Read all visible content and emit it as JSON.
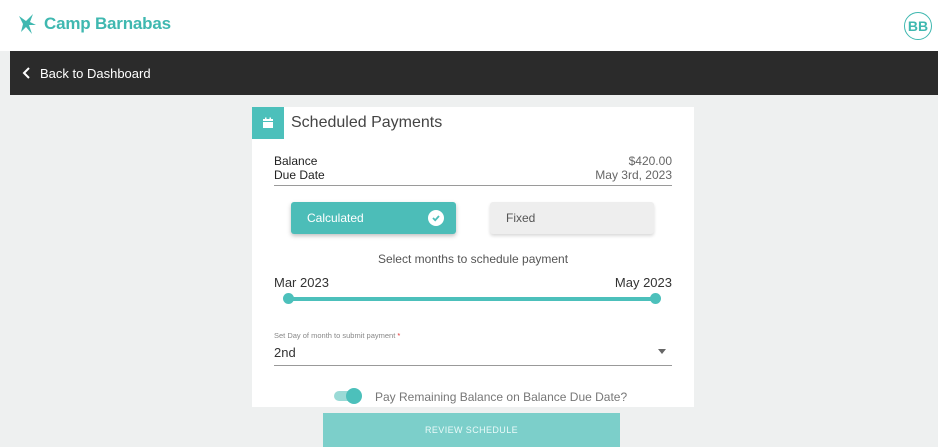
{
  "brand": {
    "name": "Camp Barnabas",
    "accent": "#3fb8b0"
  },
  "user": {
    "initials": "BB"
  },
  "nav": {
    "back_label": "Back to Dashboard"
  },
  "card": {
    "title": "Scheduled Payments",
    "balance_label": "Balance",
    "balance_value": "$420.00",
    "due_label": "Due Date",
    "due_value": "May 3rd, 2023",
    "mode_options": [
      "Calculated",
      "Fixed"
    ],
    "mode_selected": "Calculated",
    "months_prompt": "Select months to schedule payment",
    "month_start": "Mar 2023",
    "month_end": "May 2023",
    "day_field_label": "Set Day of month to submit payment",
    "day_field_required": "*",
    "day_field_value": "2nd",
    "toggle_label": "Pay Remaining Balance on Balance Due Date?",
    "toggle_on": true
  },
  "actions": {
    "review_label": "REVIEW SCHEDULE"
  },
  "icons": [
    "camp-barnabas-logo-icon",
    "chevron-left-icon",
    "calendar-icon",
    "check-circle-icon",
    "dropdown-arrow-icon"
  ]
}
